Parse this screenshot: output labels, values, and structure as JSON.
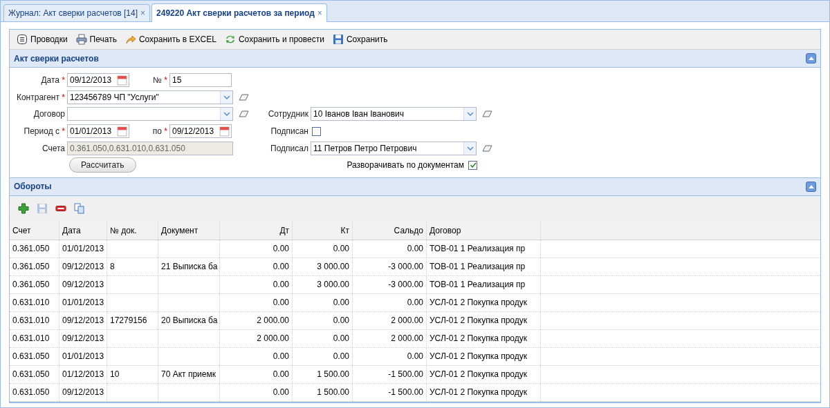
{
  "tabs": [
    {
      "label": "Журнал: Акт сверки расчетов [14]",
      "close": "×",
      "selected": false
    },
    {
      "label": "249220 Акт сверки расчетов за период",
      "close": "×",
      "selected": true
    }
  ],
  "toolbar": [
    {
      "kind": "list",
      "label": "Проводки"
    },
    {
      "kind": "print",
      "label": "Печать"
    },
    {
      "kind": "export",
      "label": "Сохранить в EXCEL"
    },
    {
      "kind": "refresh",
      "label": "Сохранить и провести"
    },
    {
      "kind": "save",
      "label": "Сохранить"
    }
  ],
  "form": {
    "title": "Акт сверки расчетов",
    "expanded": true,
    "date": {
      "label": "Дата",
      "mark": "*",
      "value": "09/12/2013"
    },
    "number": {
      "label": "№",
      "mark": "*",
      "value": "15"
    },
    "counterparty": {
      "label": "Контрагент",
      "mark": "*",
      "value": "123456789 ЧП \"Услуги\""
    },
    "contract": {
      "label": "Договор"
    },
    "period_from": {
      "label": "Период с",
      "mark": "*",
      "value": "01/01/2013"
    },
    "period_to": {
      "label": "по",
      "mark": "*",
      "value": "09/12/2013"
    },
    "accounts": {
      "label": "Счета",
      "value": "0.361.050,0.631.010,0.631.050",
      "disabled": true
    },
    "calculate_button": "Рассчитать",
    "employee": {
      "label": "Сотрудник",
      "value": "10 Іванов Іван Іванович"
    },
    "signed": {
      "label": "Подписан",
      "checked": false
    },
    "signed_by": {
      "label": "Подписал",
      "value": "11 Петров Петро Петрович"
    },
    "expand_by_documents": {
      "label": "Разворачивать по документам",
      "checked": true
    }
  },
  "grid": {
    "title": "Обороты",
    "expanded": true,
    "tools": [
      {
        "kind": "add",
        "disabled": false
      },
      {
        "kind": "save",
        "disabled": true
      },
      {
        "kind": "remove",
        "disabled": false
      },
      {
        "kind": "copy",
        "disabled": false
      }
    ],
    "columns": [
      "Счет",
      "Дата",
      "№ док.",
      "Документ",
      "Дт",
      "Кт",
      "Сальдо",
      "Договор"
    ],
    "rows": [
      [
        "0.361.050",
        "01/01/2013",
        null,
        null,
        "0.00",
        "0.00",
        "0.00",
        "ТОВ-01 1 Реализация пр"
      ],
      [
        "0.361.050",
        "09/12/2013",
        "8",
        "21 Выписка ба",
        "0.00",
        "3 000.00",
        "-3 000.00",
        "ТОВ-01 1 Реализация пр"
      ],
      [
        "0.361.050",
        "09/12/2013",
        null,
        null,
        "0.00",
        "3 000.00",
        "-3 000.00",
        "ТОВ-01 1 Реализация пр"
      ],
      [
        "0.631.010",
        "01/01/2013",
        null,
        null,
        "0.00",
        "0.00",
        "0.00",
        "УСЛ-01 2 Покупка продук"
      ],
      [
        "0.631.010",
        "09/12/2013",
        "17279156",
        "20 Выписка ба",
        "2 000.00",
        "0.00",
        "2 000.00",
        "УСЛ-01 2 Покупка продук"
      ],
      [
        "0.631.010",
        "09/12/2013",
        null,
        null,
        "2 000.00",
        "0.00",
        "2 000.00",
        "УСЛ-01 2 Покупка продук"
      ],
      [
        "0.631.050",
        "01/01/2013",
        null,
        null,
        "0.00",
        "0.00",
        "0.00",
        "УСЛ-01 2 Покупка продук"
      ],
      [
        "0.631.050",
        "01/12/2013",
        "10",
        "70 Акт приемк",
        "0.00",
        "1 500.00",
        "-1 500.00",
        "УСЛ-01 2 Покупка продук"
      ],
      [
        "0.631.050",
        "09/12/2013",
        null,
        null,
        "0.00",
        "1 500.00",
        "-1 500.00",
        "УСЛ-01 2 Покупка продук"
      ]
    ]
  }
}
